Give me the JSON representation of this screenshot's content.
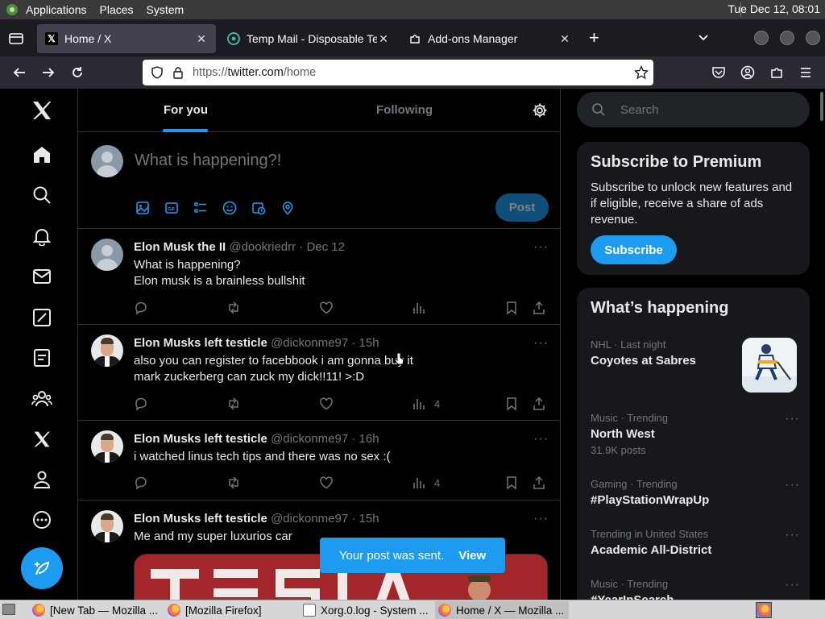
{
  "gnome_panel": {
    "menus": [
      "Applications",
      "Places",
      "System"
    ],
    "clock": "Tue Dec 12, 08:01"
  },
  "browser": {
    "tabs": [
      {
        "title": "Home / X",
        "favicon": "x-logo-icon",
        "active": true
      },
      {
        "title": "Temp Mail - Disposable Ten",
        "favicon": "tempmail-icon",
        "active": false
      },
      {
        "title": "Add-ons Manager",
        "favicon": "puzzle-icon",
        "active": false
      }
    ],
    "url_prefix": "https://",
    "url_domain": "twitter.com",
    "url_path": "/home"
  },
  "feed": {
    "tabs": [
      "For you",
      "Following"
    ],
    "active_tab": "For you",
    "composer_placeholder": "What is happening?!",
    "post_label": "Post"
  },
  "tweets": [
    {
      "name": "Elon Musk the II",
      "handle": "@dookriedrr",
      "time": "· Dec 12",
      "lines": [
        "What is happening?",
        "Elon musk is a brainless bullshit"
      ],
      "views": "",
      "avatar": "default"
    },
    {
      "name": "Elon Musks left testicle",
      "handle": "@dickonme97",
      "time": "· 15h",
      "lines": [
        "also you can register to facebbook i am gonna buy it",
        "mark zuckerberg can zuck my dick!!11! >:D"
      ],
      "views": "4",
      "avatar": "elon"
    },
    {
      "name": "Elon Musks left testicle",
      "handle": "@dickonme97",
      "time": "· 16h",
      "lines": [
        "i watched linus tech tips and there was no sex :("
      ],
      "views": "4",
      "avatar": "elon"
    },
    {
      "name": "Elon Musks left testicle",
      "handle": "@dickonme97",
      "time": "· 15h",
      "lines": [
        "Me and my super luxurios car"
      ],
      "views": "",
      "avatar": "elon"
    }
  ],
  "sidebar": {
    "search_placeholder": "Search",
    "premium": {
      "title": "Subscribe to Premium",
      "description": "Subscribe to unlock new features and if eligible, receive a share of ads revenue.",
      "button": "Subscribe"
    },
    "whats_happening_title": "What’s happening",
    "trends": [
      {
        "context": "NHL · Last night",
        "topic": "Coyotes at Sabres",
        "count": ""
      },
      {
        "context": "Music · Trending",
        "topic": "North West",
        "count": "31.9K posts"
      },
      {
        "context": "Gaming · Trending",
        "topic": "#PlayStationWrapUp",
        "count": ""
      },
      {
        "context": "Trending in United States",
        "topic": "Academic All-District",
        "count": ""
      },
      {
        "context": "Music · Trending",
        "topic": "#YearInSearch",
        "count": ""
      }
    ]
  },
  "toast": {
    "message": "Your post was sent.",
    "action": "View"
  },
  "taskbar": {
    "items": [
      {
        "label": "[New Tab — Mozilla ...",
        "icon": "firefox-icon"
      },
      {
        "label": "[Mozilla Firefox]",
        "icon": "firefox-icon"
      },
      {
        "label": "Xorg.0.log - System ...",
        "icon": "document-icon"
      },
      {
        "label": "Home / X — Mozilla ...",
        "icon": "firefox-icon"
      }
    ]
  },
  "colors": {
    "accent": "#1d9bf0",
    "background": "#000000",
    "card": "#16181c",
    "muted": "#71767b",
    "border": "#2f3336"
  }
}
